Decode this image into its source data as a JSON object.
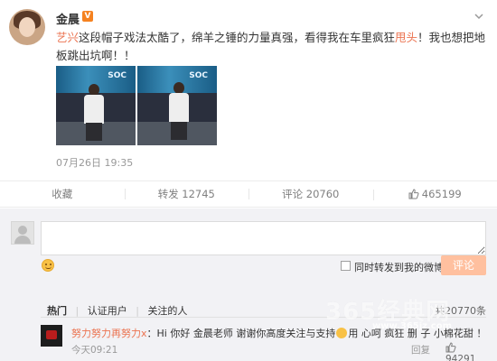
{
  "post": {
    "author": "金晨",
    "verified_badge": "V",
    "text_prefix_mention": "艺兴",
    "text_part1": "这段帽子戏法太酷了，绵羊之锤的力量真强，看得我在车里疯狂",
    "text_highlight": "甩头",
    "text_part2": "！我也想把地板跳出坑啊！！",
    "timestamp": "07月26日 19:35",
    "media_caption": "SOC"
  },
  "actions": {
    "collect_label": "收藏",
    "repost_label": "转发 12745",
    "comment_label": "评论 20760",
    "like_count": "465199"
  },
  "composer": {
    "input_value": "",
    "repost_checkbox_label": "同时转发到我的微博",
    "submit_label": "评论"
  },
  "filters": {
    "hot_label": "热门",
    "verified_label": "认证用户",
    "following_label": "关注的人",
    "total_label": "共20770条"
  },
  "comment": {
    "username": "努力努力再努力x",
    "text_before_emoji": "：Hi 你好 金晨老师 谢谢你高度关注与支持",
    "text_after_emoji": "用 心呵 疯狂 删 子 小棉花甜 ！",
    "time": "今天09:21",
    "reply_label": "回复",
    "like_count": "94291"
  },
  "watermark": {
    "main": "365经典网",
    "sub": "www.365jz.com"
  },
  "colors": {
    "accent": "#eb7350",
    "badge": "#f58220",
    "submit_bg": "#ffc09f"
  },
  "icons": {
    "more": "chevron-down-icon",
    "like": "thumb-up-icon",
    "emoji": "smiley-icon"
  }
}
